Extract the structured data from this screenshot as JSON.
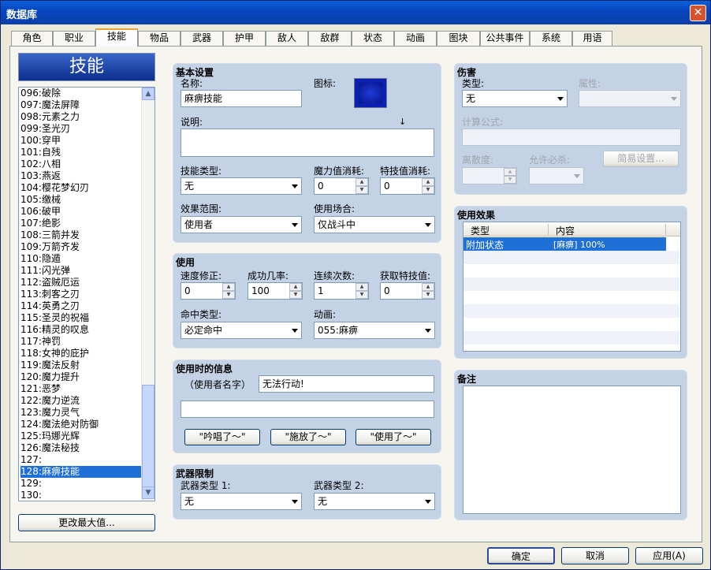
{
  "window": {
    "title": "数据库",
    "close_icon": "close-icon"
  },
  "tabs": [
    "角色",
    "职业",
    "技能",
    "物品",
    "武器",
    "护甲",
    "敌人",
    "敌群",
    "状态",
    "动画",
    "图块",
    "公共事件",
    "系统",
    "用语"
  ],
  "active_tab": "技能",
  "panel_title": "技能",
  "skills": [
    "096:破除",
    "097:魔法屏障",
    "098:元素之力",
    "099:圣光刃",
    "100:穿甲",
    "101:自残",
    "102:八相",
    "103:燕返",
    "104:樱花梦幻刃",
    "105:缴械",
    "106:破甲",
    "107:绝影",
    "108:三箭并发",
    "109:万箭齐发",
    "110:隐遁",
    "111:闪光弹",
    "112:盗贼厄运",
    "113:刺客之刃",
    "114:英勇之刃",
    "115:圣灵的祝福",
    "116:精灵的叹息",
    "117:神罚",
    "118:女神的庇护",
    "119:魔法反射",
    "120:魔力提升",
    "121:恶梦",
    "122:魔力逆流",
    "123:魔力灵气",
    "124:魔法绝对防御",
    "125:玛娜光辉",
    "126:魔法秘技",
    "127:",
    "128:麻痹技能",
    "129:",
    "130:"
  ],
  "selected_skill": "128:麻痹技能",
  "change_max_button": "更改最大值...",
  "basic": {
    "title": "基本设置",
    "name_label": "名称:",
    "name_value": "麻痹技能",
    "icon_label": "图标:",
    "desc_label": "说明:",
    "desc_value": "",
    "skill_type_label": "技能类型:",
    "skill_type_value": "无",
    "mp_cost_label": "魔力值消耗:",
    "mp_cost_value": "0",
    "tp_cost_label": "特技值消耗:",
    "tp_cost_value": "0",
    "scope_label": "效果范围:",
    "scope_value": "使用者",
    "occasion_label": "使用场合:",
    "occasion_value": "仅战斗中"
  },
  "invocation": {
    "title": "使用",
    "speed_label": "速度修正:",
    "speed_value": "0",
    "success_label": "成功几率:",
    "success_value": "100",
    "repeat_label": "连续次数:",
    "repeat_value": "1",
    "tp_gain_label": "获取特技值:",
    "tp_gain_value": "0",
    "hit_type_label": "命中类型:",
    "hit_type_value": "必定命中",
    "animation_label": "动画:",
    "animation_value": "055:麻痹"
  },
  "message": {
    "title": "使用时的信息",
    "user_name_label": "（使用者名字）",
    "line1": "无法行动!",
    "line2": "",
    "btn_cast": "\"吟唱了～\"",
    "btn_release": "\"施放了～\"",
    "btn_use": "\"使用了～\""
  },
  "weapon": {
    "title": "武器限制",
    "type1_label": "武器类型 1:",
    "type1_value": "无",
    "type2_label": "武器类型 2:",
    "type2_value": "无"
  },
  "damage": {
    "title": "伤害",
    "type_label": "类型:",
    "type_value": "无",
    "element_label": "属性:",
    "element_value": "",
    "formula_label": "计算公式:",
    "formula_value": "",
    "variance_label": "离散度:",
    "variance_value": "",
    "critical_label": "允许必杀:",
    "critical_value": "",
    "simple_button": "简易设置..."
  },
  "effects": {
    "title": "使用效果",
    "columns": [
      "类型",
      "内容"
    ],
    "rows": [
      {
        "type": "附加状态",
        "content": "[麻痹]  100%"
      }
    ]
  },
  "note": {
    "title": "备注",
    "value": ""
  },
  "footer": {
    "ok": "确定",
    "cancel": "取消",
    "apply": "应用(A)"
  }
}
